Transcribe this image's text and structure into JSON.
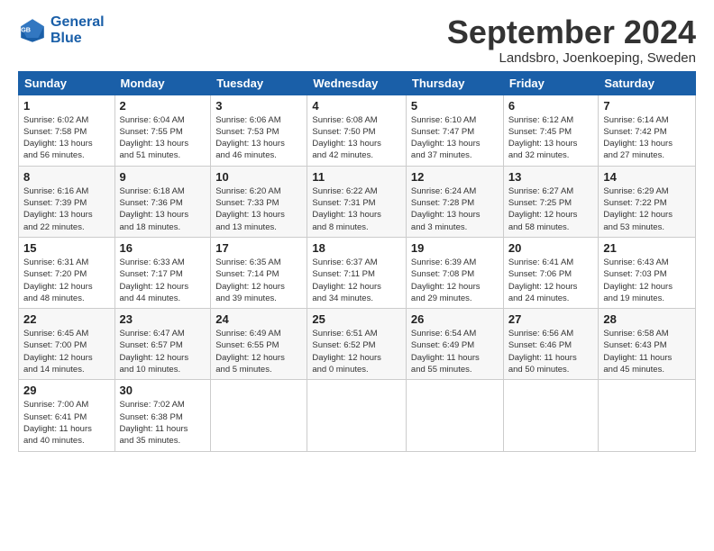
{
  "logo": {
    "line1": "General",
    "line2": "Blue"
  },
  "title": "September 2024",
  "location": "Landsbro, Joenkoeping, Sweden",
  "headers": [
    "Sunday",
    "Monday",
    "Tuesday",
    "Wednesday",
    "Thursday",
    "Friday",
    "Saturday"
  ],
  "weeks": [
    [
      {
        "day": "1",
        "info": "Sunrise: 6:02 AM\nSunset: 7:58 PM\nDaylight: 13 hours\nand 56 minutes."
      },
      {
        "day": "2",
        "info": "Sunrise: 6:04 AM\nSunset: 7:55 PM\nDaylight: 13 hours\nand 51 minutes."
      },
      {
        "day": "3",
        "info": "Sunrise: 6:06 AM\nSunset: 7:53 PM\nDaylight: 13 hours\nand 46 minutes."
      },
      {
        "day": "4",
        "info": "Sunrise: 6:08 AM\nSunset: 7:50 PM\nDaylight: 13 hours\nand 42 minutes."
      },
      {
        "day": "5",
        "info": "Sunrise: 6:10 AM\nSunset: 7:47 PM\nDaylight: 13 hours\nand 37 minutes."
      },
      {
        "day": "6",
        "info": "Sunrise: 6:12 AM\nSunset: 7:45 PM\nDaylight: 13 hours\nand 32 minutes."
      },
      {
        "day": "7",
        "info": "Sunrise: 6:14 AM\nSunset: 7:42 PM\nDaylight: 13 hours\nand 27 minutes."
      }
    ],
    [
      {
        "day": "8",
        "info": "Sunrise: 6:16 AM\nSunset: 7:39 PM\nDaylight: 13 hours\nand 22 minutes."
      },
      {
        "day": "9",
        "info": "Sunrise: 6:18 AM\nSunset: 7:36 PM\nDaylight: 13 hours\nand 18 minutes."
      },
      {
        "day": "10",
        "info": "Sunrise: 6:20 AM\nSunset: 7:33 PM\nDaylight: 13 hours\nand 13 minutes."
      },
      {
        "day": "11",
        "info": "Sunrise: 6:22 AM\nSunset: 7:31 PM\nDaylight: 13 hours\nand 8 minutes."
      },
      {
        "day": "12",
        "info": "Sunrise: 6:24 AM\nSunset: 7:28 PM\nDaylight: 13 hours\nand 3 minutes."
      },
      {
        "day": "13",
        "info": "Sunrise: 6:27 AM\nSunset: 7:25 PM\nDaylight: 12 hours\nand 58 minutes."
      },
      {
        "day": "14",
        "info": "Sunrise: 6:29 AM\nSunset: 7:22 PM\nDaylight: 12 hours\nand 53 minutes."
      }
    ],
    [
      {
        "day": "15",
        "info": "Sunrise: 6:31 AM\nSunset: 7:20 PM\nDaylight: 12 hours\nand 48 minutes."
      },
      {
        "day": "16",
        "info": "Sunrise: 6:33 AM\nSunset: 7:17 PM\nDaylight: 12 hours\nand 44 minutes."
      },
      {
        "day": "17",
        "info": "Sunrise: 6:35 AM\nSunset: 7:14 PM\nDaylight: 12 hours\nand 39 minutes."
      },
      {
        "day": "18",
        "info": "Sunrise: 6:37 AM\nSunset: 7:11 PM\nDaylight: 12 hours\nand 34 minutes."
      },
      {
        "day": "19",
        "info": "Sunrise: 6:39 AM\nSunset: 7:08 PM\nDaylight: 12 hours\nand 29 minutes."
      },
      {
        "day": "20",
        "info": "Sunrise: 6:41 AM\nSunset: 7:06 PM\nDaylight: 12 hours\nand 24 minutes."
      },
      {
        "day": "21",
        "info": "Sunrise: 6:43 AM\nSunset: 7:03 PM\nDaylight: 12 hours\nand 19 minutes."
      }
    ],
    [
      {
        "day": "22",
        "info": "Sunrise: 6:45 AM\nSunset: 7:00 PM\nDaylight: 12 hours\nand 14 minutes."
      },
      {
        "day": "23",
        "info": "Sunrise: 6:47 AM\nSunset: 6:57 PM\nDaylight: 12 hours\nand 10 minutes."
      },
      {
        "day": "24",
        "info": "Sunrise: 6:49 AM\nSunset: 6:55 PM\nDaylight: 12 hours\nand 5 minutes."
      },
      {
        "day": "25",
        "info": "Sunrise: 6:51 AM\nSunset: 6:52 PM\nDaylight: 12 hours\nand 0 minutes."
      },
      {
        "day": "26",
        "info": "Sunrise: 6:54 AM\nSunset: 6:49 PM\nDaylight: 11 hours\nand 55 minutes."
      },
      {
        "day": "27",
        "info": "Sunrise: 6:56 AM\nSunset: 6:46 PM\nDaylight: 11 hours\nand 50 minutes."
      },
      {
        "day": "28",
        "info": "Sunrise: 6:58 AM\nSunset: 6:43 PM\nDaylight: 11 hours\nand 45 minutes."
      }
    ],
    [
      {
        "day": "29",
        "info": "Sunrise: 7:00 AM\nSunset: 6:41 PM\nDaylight: 11 hours\nand 40 minutes."
      },
      {
        "day": "30",
        "info": "Sunrise: 7:02 AM\nSunset: 6:38 PM\nDaylight: 11 hours\nand 35 minutes."
      },
      {
        "day": "",
        "info": ""
      },
      {
        "day": "",
        "info": ""
      },
      {
        "day": "",
        "info": ""
      },
      {
        "day": "",
        "info": ""
      },
      {
        "day": "",
        "info": ""
      }
    ]
  ]
}
